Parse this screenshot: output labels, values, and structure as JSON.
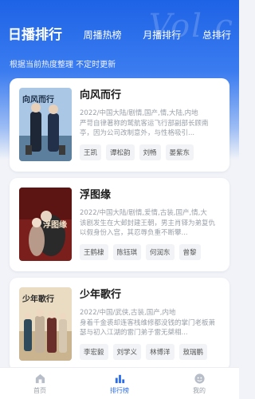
{
  "header": {
    "tabs": [
      {
        "label": "日播排行",
        "active": true
      },
      {
        "label": "周播热榜",
        "active": false
      },
      {
        "label": "月播排行",
        "active": false
      },
      {
        "label": "总排行",
        "active": false
      }
    ],
    "subtitle": "根据当前热度整理 不定时更新",
    "watermark": "Vol.c"
  },
  "cards": [
    {
      "title": "向风而行",
      "cover_title": "向风而行",
      "meta": "2022/中国大陆/剧情,国产,情,大陆,内地",
      "desc": "严苛自律著称的鹫航客运飞行部副部长顾南亭，因为公司改制意外，与性格吸引...",
      "actors": [
        "王凯",
        "谭松韵",
        "刘畅",
        "晏紫东"
      ]
    },
    {
      "title": "浮图缘",
      "cover_title": "浮图缘",
      "meta": "2022/中国大陆/剧情,爱情,古装,国产,情,大",
      "desc": "该剧发生在大邺封建王朝，男主肖铎为弟复仇以假身份入宫，其忍辱负重不断攀...",
      "actors": [
        "王鹤棣",
        "陈钰琪",
        "何润东",
        "曾黎"
      ]
    },
    {
      "title": "少年歌行",
      "cover_title": "少年歌行",
      "meta": "2022/中国/武侠,古装,国产,内地",
      "desc": "身着千金裘却连客栈维修都没钱的掌门老板萧瑟与初入江湖的雷门弟子雷无桀相...",
      "actors": [
        "李宏毅",
        "刘学义",
        "林博洋",
        "敖瑞鹏"
      ]
    }
  ],
  "nav": [
    {
      "label": "首页",
      "icon": "home-icon",
      "active": false
    },
    {
      "label": "排行榜",
      "icon": "rank-icon",
      "active": true
    },
    {
      "label": "我的",
      "icon": "profile-icon",
      "active": false
    }
  ],
  "colors": {
    "accent": "#2b6de8",
    "header_top": "#1e63e6",
    "muted": "#9aa0a8"
  }
}
